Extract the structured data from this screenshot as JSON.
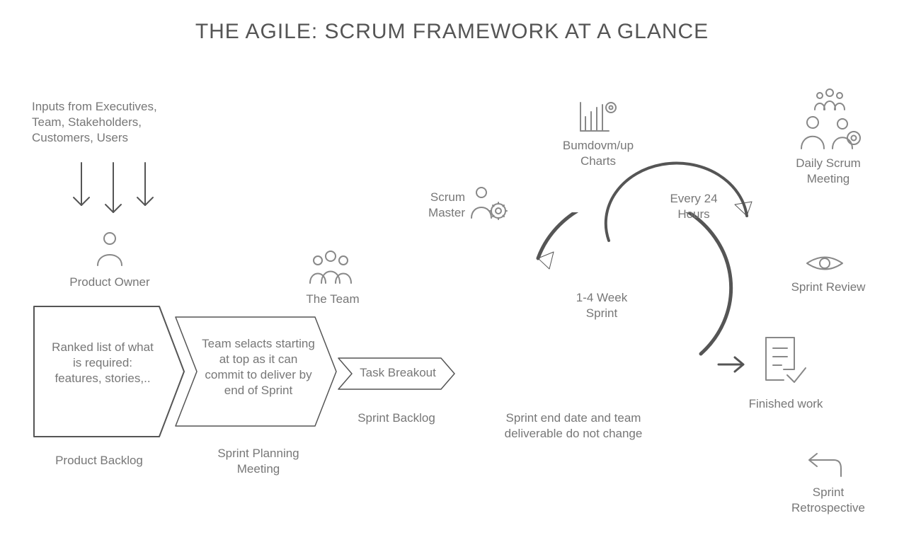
{
  "title": "THE AGILE: SCRUM FRAMEWORK AT A GLANCE",
  "inputs_label": "Inputs from Executives, Team, Stakeholders, Customers, Users",
  "product_owner_label": "Product Owner",
  "product_backlog_box": "Ranked list of what is required: features, stories,..",
  "product_backlog_label": "Product Backlog",
  "sprint_planning_box": "Team selacts starting at top as it can commit to deliver by end of Sprint",
  "sprint_planning_label": "Sprint Planning Meeting",
  "task_breakout_label": "Task Breakout",
  "sprint_backlog_label": "Sprint Backlog",
  "the_team_label": "The Team",
  "scrum_master_label": "Scrum Master",
  "burndown_label": "Bumdovm/up Charts",
  "every24_label": "Every 24 Hours",
  "sprint_duration_label": "1-4 Week Sprint",
  "sprint_end_note": "Sprint end date and team deliverable do not change",
  "daily_scrum_label": "Daily Scrum Meeting",
  "sprint_review_label": "Sprint Review",
  "finished_work_label": "Finished work",
  "sprint_retro_label": "Sprint Retrospective"
}
